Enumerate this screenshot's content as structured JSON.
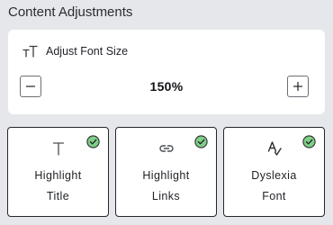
{
  "section": {
    "title": "Content Adjustments"
  },
  "font_size": {
    "label": "Adjust Font Size",
    "value": "150%",
    "icon": "font-size-icon",
    "decrease_icon": "minus-icon",
    "increase_icon": "plus-icon"
  },
  "tiles": [
    {
      "line1": "Highlight",
      "line2": "Title",
      "icon": "title-t-icon",
      "active": true
    },
    {
      "line1": "Highlight",
      "line2": "Links",
      "icon": "link-icon",
      "active": true
    },
    {
      "line1": "Dyslexia",
      "line2": "Font",
      "icon": "dyslexia-font-icon",
      "active": true
    }
  ],
  "colors": {
    "background": "#e5e7ea",
    "card": "#ffffff",
    "check_fill": "#7fcf86",
    "check_stroke": "#2a2d31",
    "text": "#1f2126"
  }
}
